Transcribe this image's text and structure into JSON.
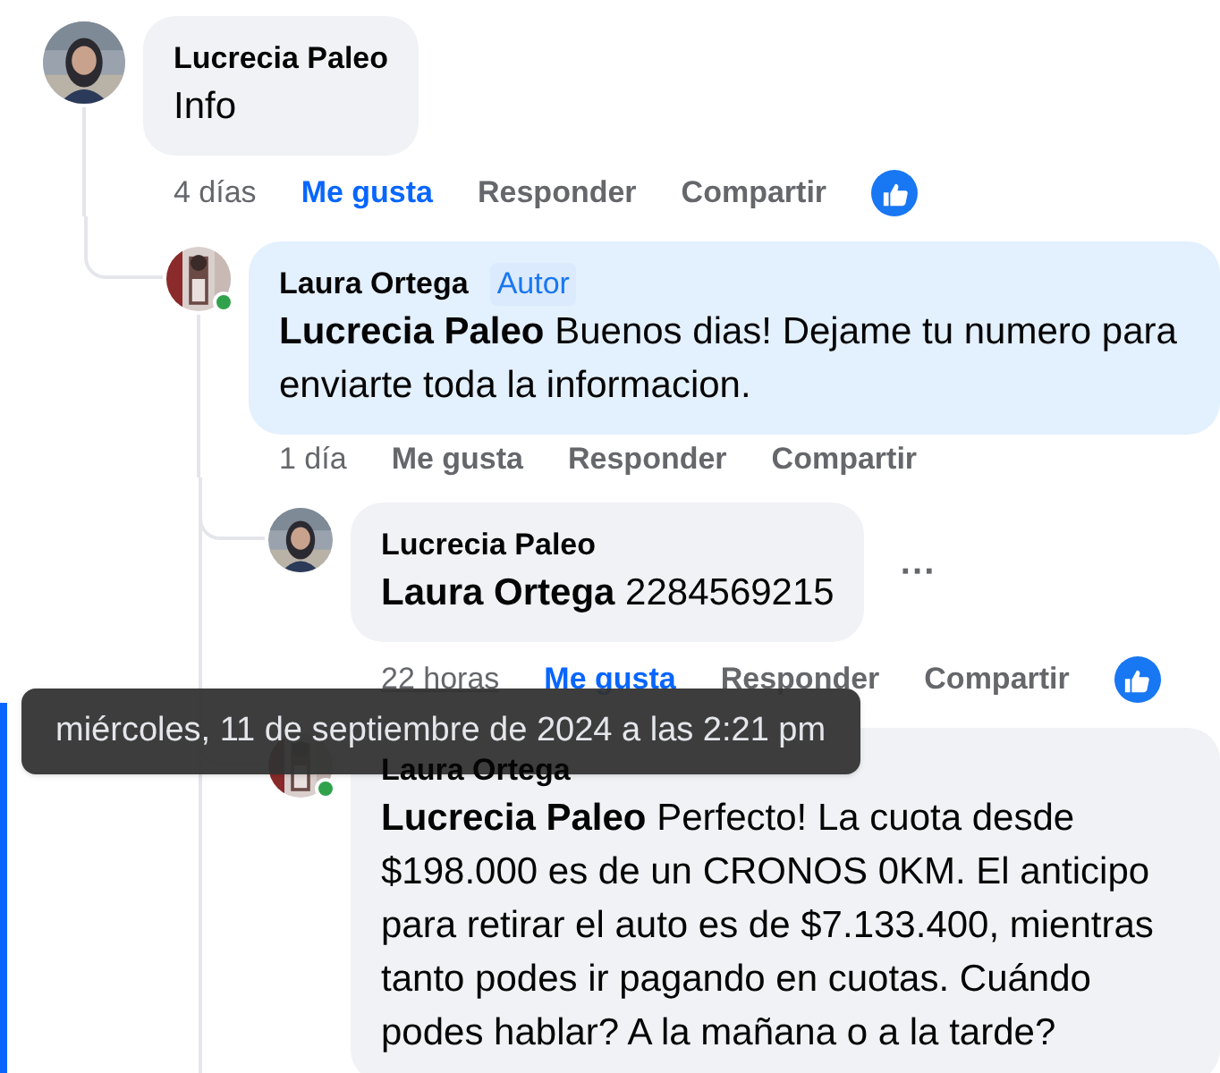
{
  "comments": [
    {
      "author": "Lucrecia Paleo",
      "text": "Info",
      "highlighted": false,
      "time": "4 días",
      "time_hovered": false,
      "actions": [
        {
          "label": "Me gusta",
          "selected": true
        },
        {
          "label": "Responder",
          "selected": false
        },
        {
          "label": "Compartir",
          "selected": false
        }
      ],
      "reaction_shown": true,
      "children": [
        {
          "author": "Laura Ortega",
          "badge": "Autor",
          "text": "**Lucrecia Paleo** Buenos dias! Dejame tu numero para enviarte toda la informacion.",
          "online": true,
          "highlighted": true,
          "time": "1 día",
          "time_hovered": false,
          "actions": [
            {
              "label": "Me gusta",
              "selected": false
            },
            {
              "label": "Responder",
              "selected": false
            },
            {
              "label": "Compartir",
              "selected": false
            }
          ],
          "continued": true,
          "children": [
            {
              "author": "Lucrecia Paleo",
              "text": "**Laura Ortega** 2284569215",
              "more": "···",
              "highlighted": false,
              "time": "22 horas",
              "time_hovered": true,
              "actions": [
                {
                  "label": "Me gusta",
                  "selected": true
                },
                {
                  "label": "Responder",
                  "selected": false
                },
                {
                  "label": "Compartir",
                  "selected": false
                }
              ],
              "reaction_shown": true
            },
            {
              "author": "Laura Ortega",
              "text": "**Lucrecia Paleo** Perfecto! La cuota desde $198.000 es de un CRONOS 0KM. El anticipo para retirar el auto es de $7.133.400, mientras tanto podes ir pagando en cuotas. Cuándo podes hablar? A la mañana o a la tarde?",
              "online": true,
              "highlighted": false
            }
          ]
        }
      ]
    }
  ],
  "tooltip": {
    "text": "miércoles, 11 de septiembre de 2024 a las 2:21 pm"
  },
  "focus_bar": {
    "shown": true
  }
}
